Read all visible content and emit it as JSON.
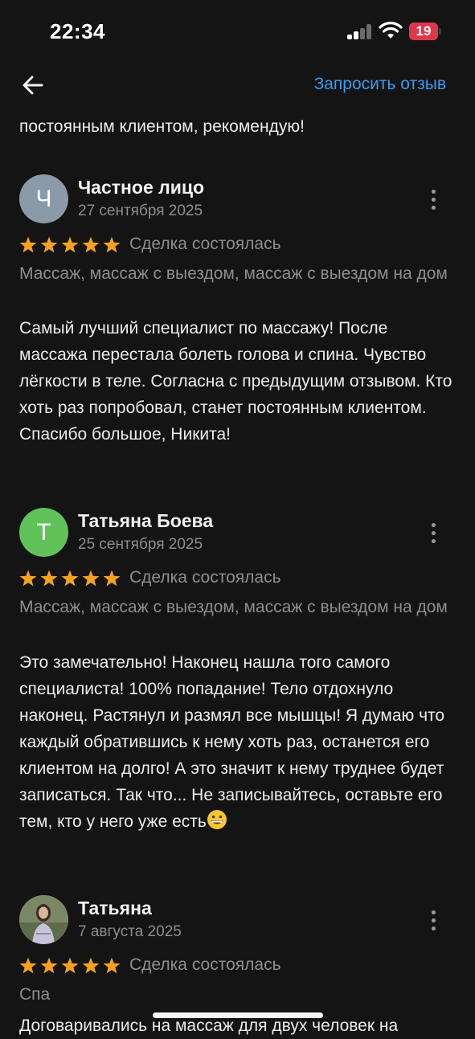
{
  "status_bar": {
    "time": "22:34",
    "battery_level": "19",
    "battery_color": "#e0364a",
    "signal_icon": "cellular-signal-icon",
    "wifi_icon": "wifi-icon"
  },
  "header": {
    "back_icon": "arrow-left-icon",
    "request_review_label": "Запросить отзыв",
    "accent_color": "#3a9cf0"
  },
  "previous_review_tail": "постоянным клиентом, рекомендую!",
  "reviews": [
    {
      "avatar_letter": "Ч",
      "avatar_color": "#8a9aa8",
      "author": "Частное лицо",
      "date": "27 сентября 2025",
      "rating": 5,
      "deal_status": "Сделка состоялась",
      "services": "Массаж, массаж с выездом, массаж с выездом на дом",
      "text": "Самый лучший специалист по массажу! После массажа перестала болеть голова и спина. Чувство лёгкости в теле. Согласна с предыдущим отзывом. Кто хоть раз попробовал, станет постоянным клиентом. Спасибо большое, Никита!"
    },
    {
      "avatar_letter": "Т",
      "avatar_color": "#5fc35a",
      "author": "Татьяна Боева",
      "date": "25 сентября 2025",
      "rating": 5,
      "deal_status": "Сделка состоялась",
      "services": "Массаж, массаж с выездом, массаж с выездом на дом",
      "text": "Это замечательно! Наконец нашла того самого специалиста! 100% попадание! Тело отдохнуло наконец. Растянул и размял все мышцы! Я думаю что каждый обратившись к нему хоть раз, останется его клиентом на долго! А это значит к нему труднее будет записаться. Так что... Не записывайтесь, оставьте его тем, кто у него уже есть",
      "emoji": "grinning-face-emoji"
    },
    {
      "avatar_letter": "",
      "avatar_color": "#7a8a6a",
      "avatar_type": "photo",
      "author": "Татьяна",
      "date": "7 августа 2025",
      "rating": 5,
      "deal_status": "Сделка состоялась",
      "services": "Спа",
      "text": "Договаривались на массаж для двух человек на"
    }
  ],
  "star_color": "#f6a21c"
}
